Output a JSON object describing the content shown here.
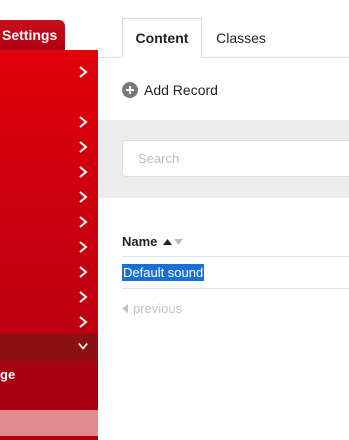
{
  "sidebar": {
    "header_label": "Settings",
    "sub_label": "ge",
    "chevron_count_collapsed": 10
  },
  "tabs": [
    {
      "label": "Content",
      "active": true
    },
    {
      "label": "Classes",
      "active": false
    }
  ],
  "toolbar": {
    "add_record_label": "Add Record"
  },
  "search": {
    "placeholder": "Search",
    "value": ""
  },
  "table": {
    "columns": [
      {
        "label": "Name",
        "sort": "ascending"
      }
    ],
    "rows": [
      {
        "name": "Default sound",
        "selected": true
      }
    ]
  },
  "pagination": {
    "previous_label": "previous"
  },
  "colors": {
    "brand_red": "#d0000d",
    "sidebar_expanded": "#8b1014",
    "sidebar_active": "#e08a8d",
    "selection": "#1a6fd6"
  }
}
